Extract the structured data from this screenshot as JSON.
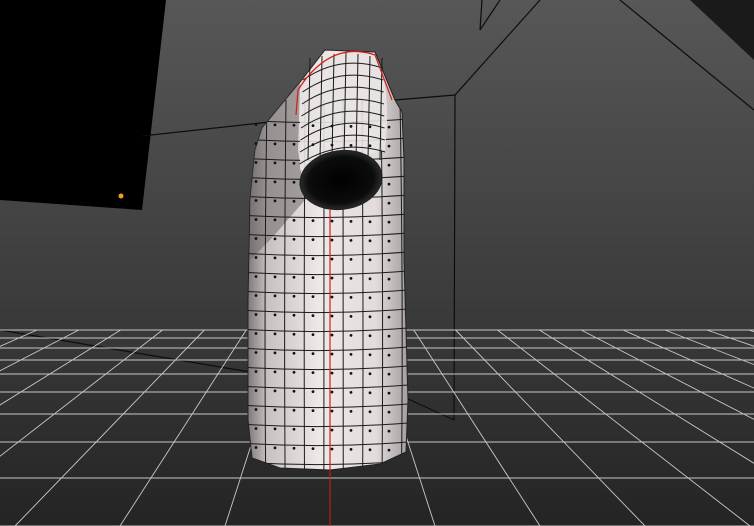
{
  "viewport": {
    "label": "",
    "background_top": "#555555",
    "background_bottom": "#262626",
    "grid_color": "#c8c8c8",
    "wire_color": "#1a1a1a",
    "seam_color": "#d21e14",
    "mesh_fill_light": "#e8e2e2",
    "mesh_fill_shadow": "#8f8a8a",
    "selected_vertex_color": "#f0a020"
  },
  "scene": {
    "object": "tshirt-mesh",
    "view": "perspective",
    "grid": true
  }
}
